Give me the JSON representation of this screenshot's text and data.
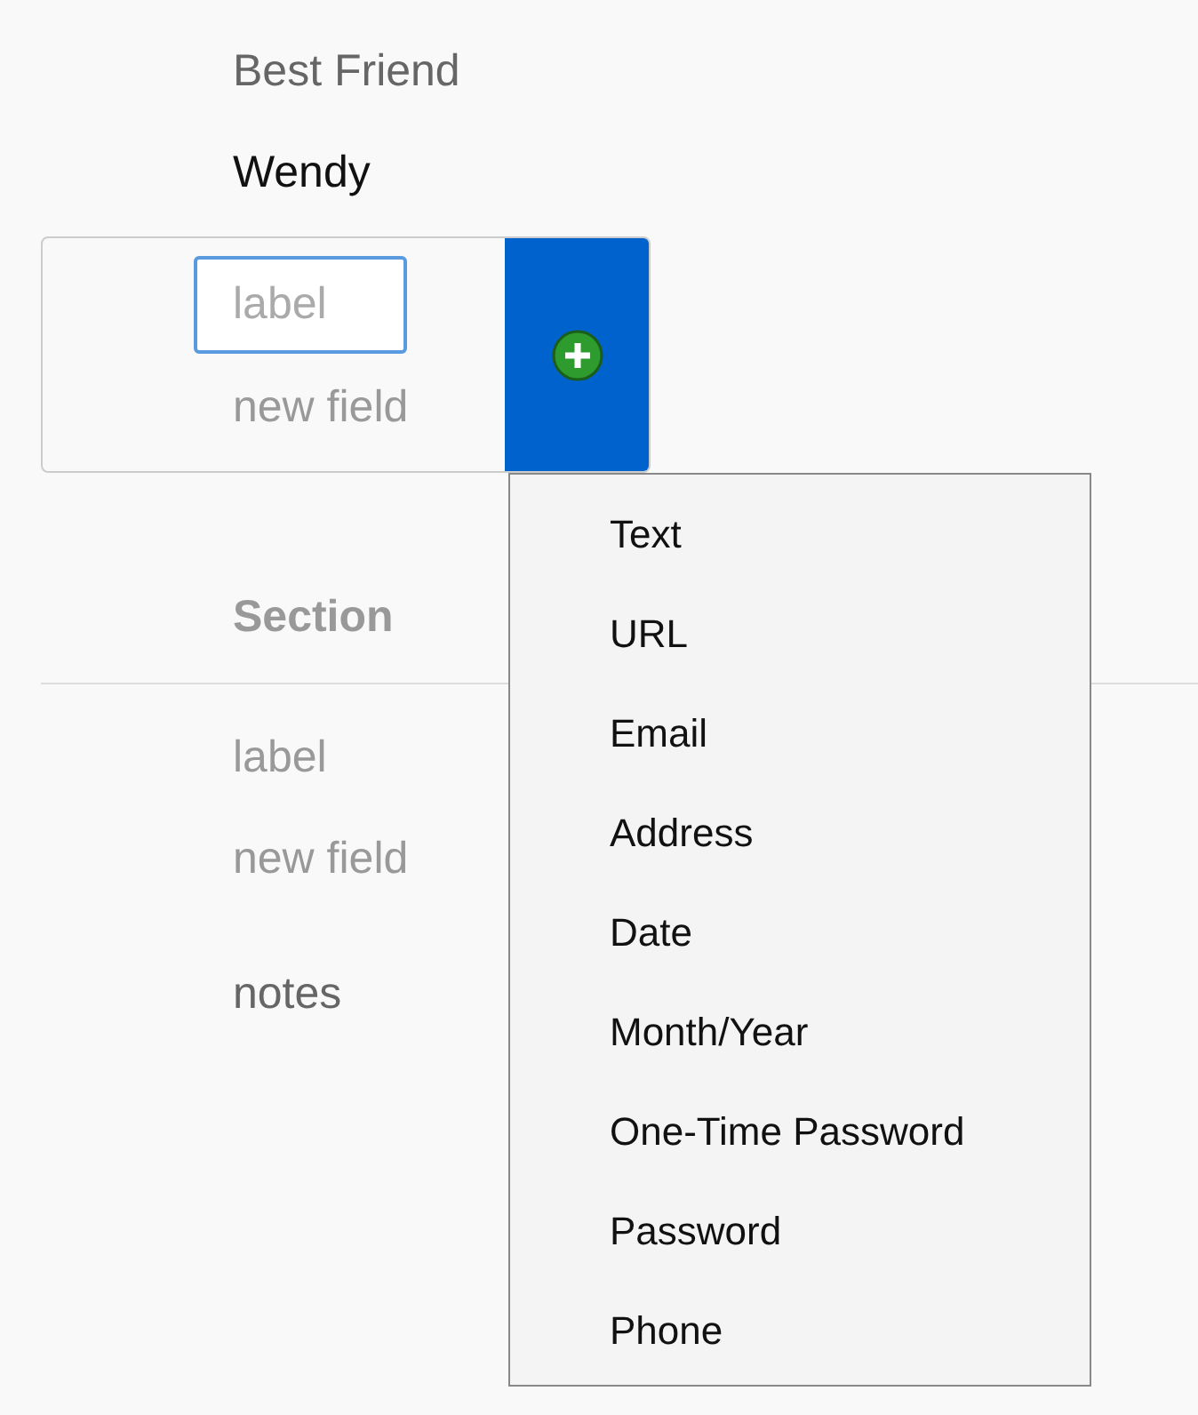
{
  "field": {
    "label": "Best Friend",
    "value": "Wendy"
  },
  "new_field_card": {
    "label_input": {
      "placeholder": "label",
      "focused": true
    },
    "value_hint": "new field"
  },
  "add_menu": {
    "expanded": true,
    "items": [
      "Text",
      "URL",
      "Email",
      "Address",
      "Date",
      "Month/Year",
      "One-Time Password",
      "Password",
      "Phone"
    ]
  },
  "section": {
    "title": "Section",
    "label_hint": "label",
    "value_hint": "new field"
  },
  "notes": "notes"
}
